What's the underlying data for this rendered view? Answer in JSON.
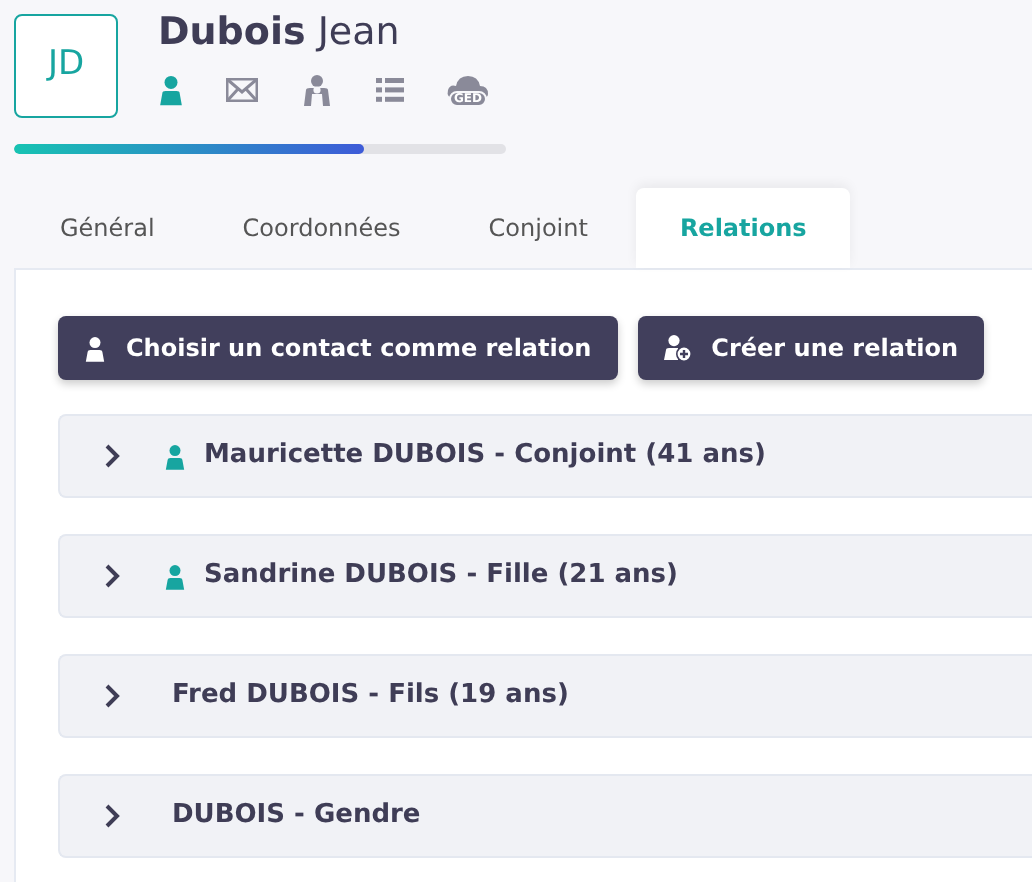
{
  "avatar": {
    "initials": "JD"
  },
  "name": {
    "last": "Dubois",
    "first": "Jean"
  },
  "header_icons": [
    {
      "kind": "person",
      "selected": true
    },
    {
      "kind": "mail",
      "selected": false
    },
    {
      "kind": "group",
      "selected": false
    },
    {
      "kind": "list",
      "selected": false
    },
    {
      "kind": "ged",
      "label": "GED",
      "selected": false
    }
  ],
  "progress": {
    "level": 0.71
  },
  "tabs": [
    {
      "label": "Général",
      "selected": false
    },
    {
      "label": "Coordonnées",
      "selected": false
    },
    {
      "label": "Conjoint",
      "selected": false
    },
    {
      "label": "Relations",
      "selected": true
    }
  ],
  "buttons": [
    {
      "kind": "person",
      "label": "Choisir un contact comme relation"
    },
    {
      "kind": "person-add",
      "label": "Créer une relation"
    }
  ],
  "relations": [
    {
      "label": "Mauricette DUBOIS - Conjoint (41 ans)",
      "is_contact": true,
      "expanded": false
    },
    {
      "label": "Sandrine DUBOIS - Fille (21 ans)",
      "is_contact": true,
      "expanded": false
    },
    {
      "label": "Fred DUBOIS - Fils (19 ans)",
      "is_contact": false,
      "expanded": false
    },
    {
      "label": "DUBOIS - Gendre",
      "is_contact": false,
      "expanded": false
    }
  ]
}
